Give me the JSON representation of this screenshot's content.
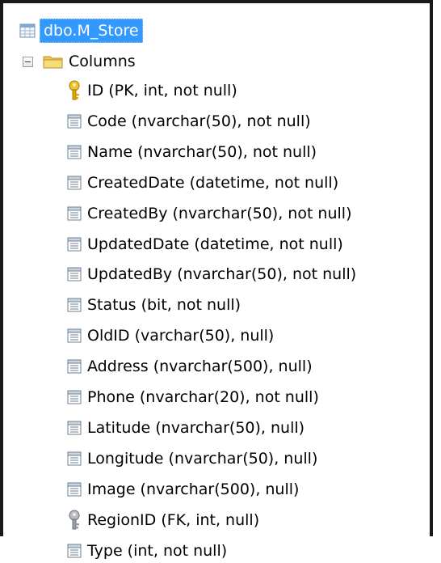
{
  "table_node": {
    "label": "dbo.M_Store",
    "icon": "table-icon"
  },
  "columns_node": {
    "label": "Columns",
    "icon": "folder-icon",
    "expander": "collapse-icon"
  },
  "columns": [
    {
      "label": "ID (PK, int, not null)",
      "icon": "primary-key-icon"
    },
    {
      "label": "Code (nvarchar(50), not null)",
      "icon": "column-icon"
    },
    {
      "label": "Name (nvarchar(50), not null)",
      "icon": "column-icon"
    },
    {
      "label": "CreatedDate (datetime, not null)",
      "icon": "column-icon"
    },
    {
      "label": "CreatedBy (nvarchar(50), not null)",
      "icon": "column-icon"
    },
    {
      "label": "UpdatedDate (datetime, not null)",
      "icon": "column-icon"
    },
    {
      "label": "UpdatedBy (nvarchar(50), not null)",
      "icon": "column-icon"
    },
    {
      "label": "Status (bit, not null)",
      "icon": "column-icon"
    },
    {
      "label": "OldID (varchar(50), null)",
      "icon": "column-icon"
    },
    {
      "label": "Address (nvarchar(500), null)",
      "icon": "column-icon"
    },
    {
      "label": "Phone (nvarchar(20), not null)",
      "icon": "column-icon"
    },
    {
      "label": "Latitude (nvarchar(50), null)",
      "icon": "column-icon"
    },
    {
      "label": "Longitude (nvarchar(50), null)",
      "icon": "column-icon"
    },
    {
      "label": "Image (nvarchar(500), null)",
      "icon": "column-icon"
    },
    {
      "label": "RegionID (FK, int, null)",
      "icon": "foreign-key-icon"
    },
    {
      "label": "Type (int, not null)",
      "icon": "column-icon"
    }
  ]
}
